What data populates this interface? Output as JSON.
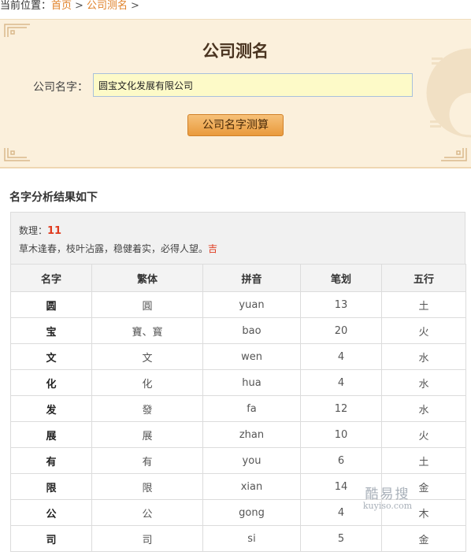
{
  "breadcrumb": {
    "prefix": "当前位置：",
    "home": "首页",
    "sep": ">",
    "current": "公司测名",
    "trail": ">"
  },
  "form": {
    "title": "公司测名",
    "label": "公司名字：",
    "value": "圆宝文化发展有限公司",
    "button": "公司名字测算"
  },
  "result": {
    "heading": "名字分析结果如下",
    "number_label": "数理：",
    "number_value": "11",
    "description": "草木逢春，枝叶沾露，稳健着实，必得人望。",
    "luck": "吉",
    "columns": [
      "名字",
      "繁体",
      "拼音",
      "笔划",
      "五行"
    ],
    "rows": [
      [
        "圆",
        "圓",
        "yuan",
        "13",
        "土"
      ],
      [
        "宝",
        "寶、寳",
        "bao",
        "20",
        "火"
      ],
      [
        "文",
        "文",
        "wen",
        "4",
        "水"
      ],
      [
        "化",
        "化",
        "hua",
        "4",
        "水"
      ],
      [
        "发",
        "發",
        "fa",
        "12",
        "水"
      ],
      [
        "展",
        "展",
        "zhan",
        "10",
        "火"
      ],
      [
        "有",
        "有",
        "you",
        "6",
        "土"
      ],
      [
        "限",
        "限",
        "xian",
        "14",
        "金"
      ],
      [
        "公",
        "公",
        "gong",
        "4",
        "木"
      ],
      [
        "司",
        "司",
        "si",
        "5",
        "金"
      ]
    ]
  },
  "watermark": {
    "cn": "酷易搜",
    "en": "kuyiso.com"
  },
  "colors": {
    "accent": "#e0822a",
    "panel_bg": "#fbf0dc",
    "lucky": "#e03a1e",
    "input_bg": "#fdfac8"
  }
}
